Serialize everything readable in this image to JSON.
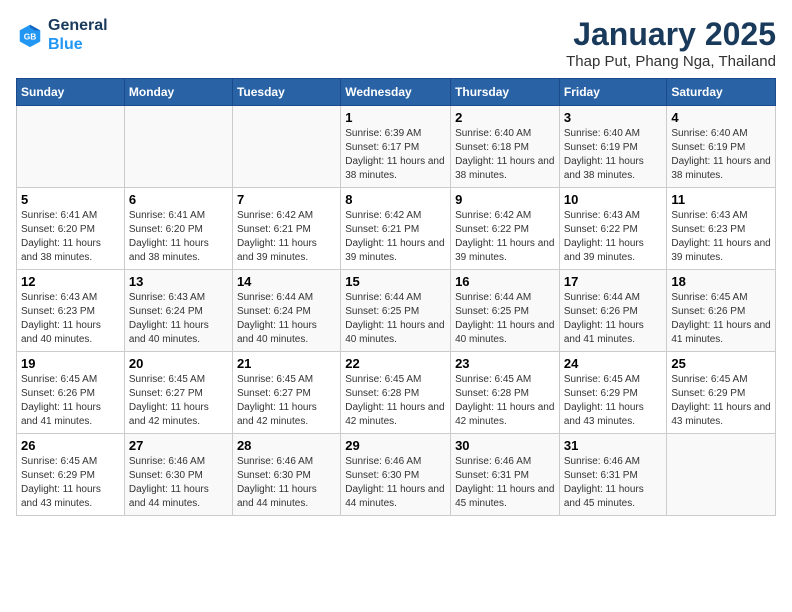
{
  "logo": {
    "line1": "General",
    "line2": "Blue"
  },
  "title": "January 2025",
  "subtitle": "Thap Put, Phang Nga, Thailand",
  "days_of_week": [
    "Sunday",
    "Monday",
    "Tuesday",
    "Wednesday",
    "Thursday",
    "Friday",
    "Saturday"
  ],
  "weeks": [
    [
      {
        "day": "",
        "info": ""
      },
      {
        "day": "",
        "info": ""
      },
      {
        "day": "",
        "info": ""
      },
      {
        "day": "1",
        "info": "Sunrise: 6:39 AM\nSunset: 6:17 PM\nDaylight: 11 hours and 38 minutes."
      },
      {
        "day": "2",
        "info": "Sunrise: 6:40 AM\nSunset: 6:18 PM\nDaylight: 11 hours and 38 minutes."
      },
      {
        "day": "3",
        "info": "Sunrise: 6:40 AM\nSunset: 6:19 PM\nDaylight: 11 hours and 38 minutes."
      },
      {
        "day": "4",
        "info": "Sunrise: 6:40 AM\nSunset: 6:19 PM\nDaylight: 11 hours and 38 minutes."
      }
    ],
    [
      {
        "day": "5",
        "info": "Sunrise: 6:41 AM\nSunset: 6:20 PM\nDaylight: 11 hours and 38 minutes."
      },
      {
        "day": "6",
        "info": "Sunrise: 6:41 AM\nSunset: 6:20 PM\nDaylight: 11 hours and 38 minutes."
      },
      {
        "day": "7",
        "info": "Sunrise: 6:42 AM\nSunset: 6:21 PM\nDaylight: 11 hours and 39 minutes."
      },
      {
        "day": "8",
        "info": "Sunrise: 6:42 AM\nSunset: 6:21 PM\nDaylight: 11 hours and 39 minutes."
      },
      {
        "day": "9",
        "info": "Sunrise: 6:42 AM\nSunset: 6:22 PM\nDaylight: 11 hours and 39 minutes."
      },
      {
        "day": "10",
        "info": "Sunrise: 6:43 AM\nSunset: 6:22 PM\nDaylight: 11 hours and 39 minutes."
      },
      {
        "day": "11",
        "info": "Sunrise: 6:43 AM\nSunset: 6:23 PM\nDaylight: 11 hours and 39 minutes."
      }
    ],
    [
      {
        "day": "12",
        "info": "Sunrise: 6:43 AM\nSunset: 6:23 PM\nDaylight: 11 hours and 40 minutes."
      },
      {
        "day": "13",
        "info": "Sunrise: 6:43 AM\nSunset: 6:24 PM\nDaylight: 11 hours and 40 minutes."
      },
      {
        "day": "14",
        "info": "Sunrise: 6:44 AM\nSunset: 6:24 PM\nDaylight: 11 hours and 40 minutes."
      },
      {
        "day": "15",
        "info": "Sunrise: 6:44 AM\nSunset: 6:25 PM\nDaylight: 11 hours and 40 minutes."
      },
      {
        "day": "16",
        "info": "Sunrise: 6:44 AM\nSunset: 6:25 PM\nDaylight: 11 hours and 40 minutes."
      },
      {
        "day": "17",
        "info": "Sunrise: 6:44 AM\nSunset: 6:26 PM\nDaylight: 11 hours and 41 minutes."
      },
      {
        "day": "18",
        "info": "Sunrise: 6:45 AM\nSunset: 6:26 PM\nDaylight: 11 hours and 41 minutes."
      }
    ],
    [
      {
        "day": "19",
        "info": "Sunrise: 6:45 AM\nSunset: 6:26 PM\nDaylight: 11 hours and 41 minutes."
      },
      {
        "day": "20",
        "info": "Sunrise: 6:45 AM\nSunset: 6:27 PM\nDaylight: 11 hours and 42 minutes."
      },
      {
        "day": "21",
        "info": "Sunrise: 6:45 AM\nSunset: 6:27 PM\nDaylight: 11 hours and 42 minutes."
      },
      {
        "day": "22",
        "info": "Sunrise: 6:45 AM\nSunset: 6:28 PM\nDaylight: 11 hours and 42 minutes."
      },
      {
        "day": "23",
        "info": "Sunrise: 6:45 AM\nSunset: 6:28 PM\nDaylight: 11 hours and 42 minutes."
      },
      {
        "day": "24",
        "info": "Sunrise: 6:45 AM\nSunset: 6:29 PM\nDaylight: 11 hours and 43 minutes."
      },
      {
        "day": "25",
        "info": "Sunrise: 6:45 AM\nSunset: 6:29 PM\nDaylight: 11 hours and 43 minutes."
      }
    ],
    [
      {
        "day": "26",
        "info": "Sunrise: 6:45 AM\nSunset: 6:29 PM\nDaylight: 11 hours and 43 minutes."
      },
      {
        "day": "27",
        "info": "Sunrise: 6:46 AM\nSunset: 6:30 PM\nDaylight: 11 hours and 44 minutes."
      },
      {
        "day": "28",
        "info": "Sunrise: 6:46 AM\nSunset: 6:30 PM\nDaylight: 11 hours and 44 minutes."
      },
      {
        "day": "29",
        "info": "Sunrise: 6:46 AM\nSunset: 6:30 PM\nDaylight: 11 hours and 44 minutes."
      },
      {
        "day": "30",
        "info": "Sunrise: 6:46 AM\nSunset: 6:31 PM\nDaylight: 11 hours and 45 minutes."
      },
      {
        "day": "31",
        "info": "Sunrise: 6:46 AM\nSunset: 6:31 PM\nDaylight: 11 hours and 45 minutes."
      },
      {
        "day": "",
        "info": ""
      }
    ]
  ]
}
